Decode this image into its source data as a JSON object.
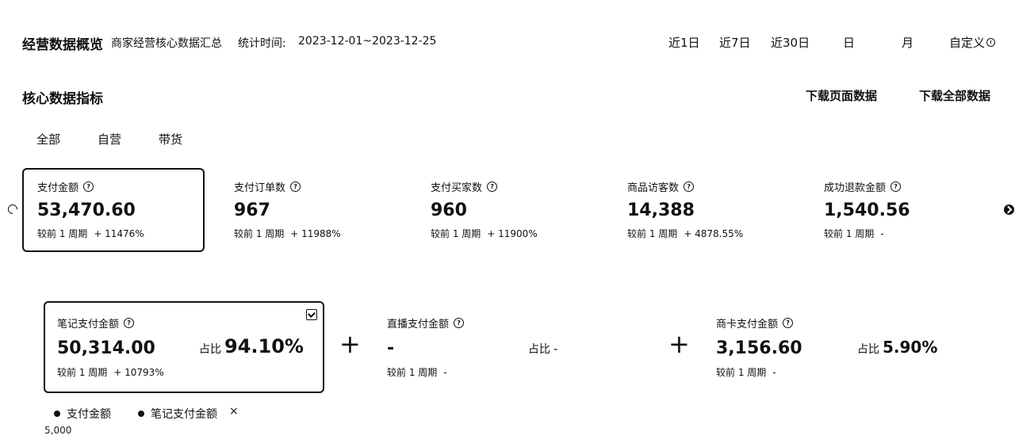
{
  "header": {
    "title": "经营数据概览",
    "subtitle": "商家经营核心数据汇总",
    "time_label": "统计时间:",
    "time_range": "2023-12-01~2023-12-25",
    "ranges": [
      "近1日",
      "近7日",
      "近30日",
      "日",
      "月"
    ],
    "custom_label": "自定义",
    "custom_icon": "info-icon"
  },
  "section": {
    "title": "核心数据指标",
    "download_page": "下载页面数据",
    "download_all": "下载全部数据"
  },
  "subtabs": [
    "全部",
    "自营",
    "带货"
  ],
  "cards": [
    {
      "label": "支付金额",
      "value": "53,470.60",
      "compare": "较前 1 周期",
      "change": "+ 11476%"
    },
    {
      "label": "支付订单数",
      "value": "967",
      "compare": "较前 1 周期",
      "change": "+ 11988%"
    },
    {
      "label": "支付买家数",
      "value": "960",
      "compare": "较前 1 周期",
      "change": "+ 11900%"
    },
    {
      "label": "商品访客数",
      "value": "14,388",
      "compare": "较前 1 周期",
      "change": "+ 4878.55%"
    },
    {
      "label": "成功退款金额",
      "value": "1,540.56",
      "compare": "较前 1 周期",
      "change": "-"
    }
  ],
  "breakdown": [
    {
      "label": "笔记支付金额",
      "value": "50,314.00",
      "compare": "较前 1 周期",
      "change": "+ 10793%",
      "ratio_label": "占比",
      "ratio": "94.10%"
    },
    {
      "label": "直播支付金额",
      "value": "-",
      "compare": "较前 1 周期",
      "change": "-",
      "ratio_label": "占比",
      "ratio": "-"
    },
    {
      "label": "商卡支付金额",
      "value": "3,156.60",
      "compare": "较前 1 周期",
      "change": "-",
      "ratio_label": "占比",
      "ratio": "5.90%"
    }
  ],
  "plus_sign": "+",
  "legend": {
    "items": [
      "支付金额",
      "笔记支付金额"
    ],
    "close": "×",
    "y_tick": "5,000"
  },
  "colors": {
    "text": "#111111",
    "background": "#ffffff"
  }
}
